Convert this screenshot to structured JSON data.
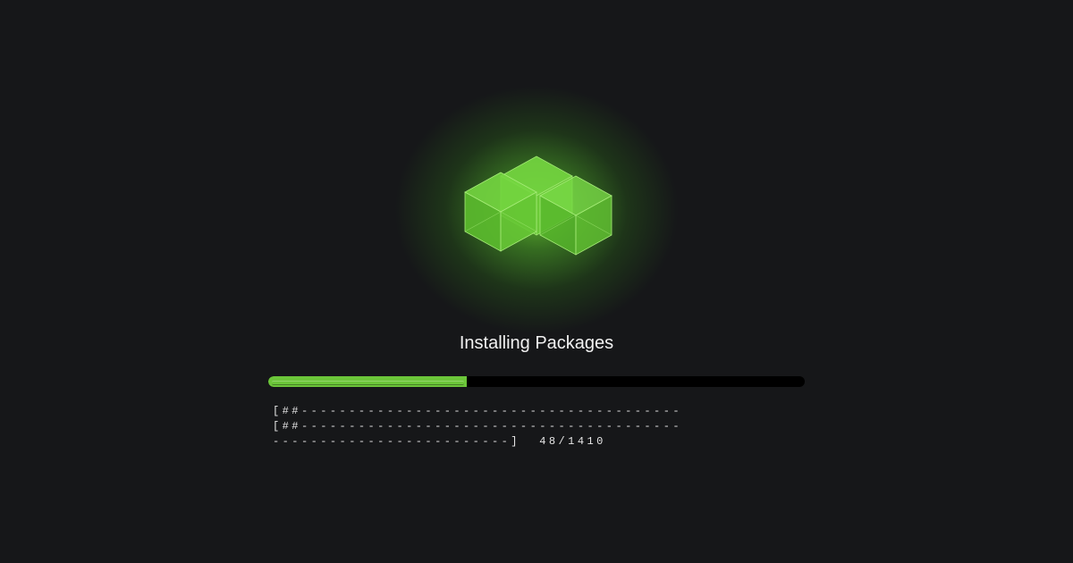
{
  "logo": {
    "icon": "package-cubes-icon",
    "color": "#6cc63a"
  },
  "title": "Installing Packages",
  "progress": {
    "done": 48,
    "total": 1410,
    "fraction": 0.37,
    "fill_color": "#6cc63a",
    "track_color": "#000000"
  },
  "log": {
    "lines": [
      "[##----------------------------------------",
      "[##----------------------------------------",
      "-------------------------]  48/1410"
    ]
  }
}
